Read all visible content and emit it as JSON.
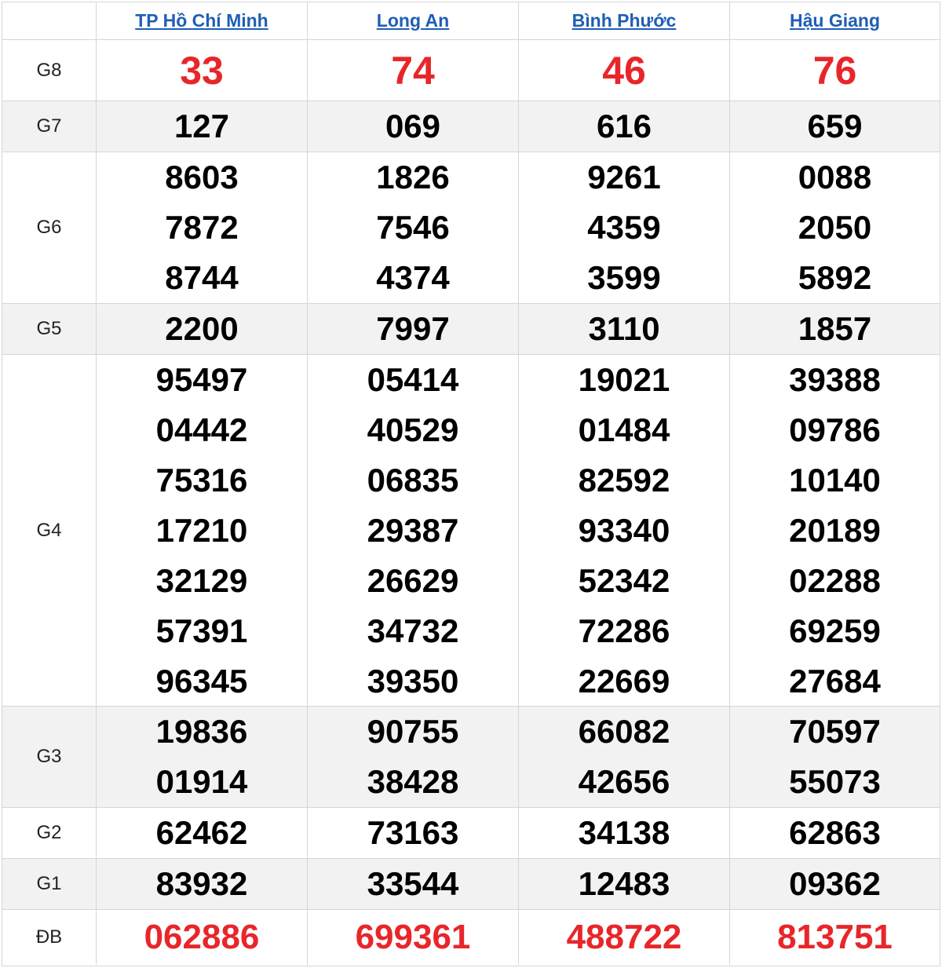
{
  "header": {
    "provinces": [
      "TP Hồ Chí Minh",
      "Long An",
      "Bình Phước",
      "Hậu Giang"
    ]
  },
  "colors": {
    "red": "#e8262a",
    "link": "#1f5eb5",
    "alt_row": "#f2f2f2"
  },
  "rows": [
    {
      "label": "G8",
      "style": "red-big",
      "cols": [
        [
          "33"
        ],
        [
          "74"
        ],
        [
          "46"
        ],
        [
          "76"
        ]
      ]
    },
    {
      "label": "G7",
      "style": "normal",
      "cols": [
        [
          "127"
        ],
        [
          "069"
        ],
        [
          "616"
        ],
        [
          "659"
        ]
      ]
    },
    {
      "label": "G6",
      "style": "normal",
      "cols": [
        [
          "8603",
          "7872",
          "8744"
        ],
        [
          "1826",
          "7546",
          "4374"
        ],
        [
          "9261",
          "4359",
          "3599"
        ],
        [
          "0088",
          "2050",
          "5892"
        ]
      ]
    },
    {
      "label": "G5",
      "style": "normal",
      "cols": [
        [
          "2200"
        ],
        [
          "7997"
        ],
        [
          "3110"
        ],
        [
          "1857"
        ]
      ]
    },
    {
      "label": "G4",
      "style": "normal",
      "cols": [
        [
          "95497",
          "04442",
          "75316",
          "17210",
          "32129",
          "57391",
          "96345"
        ],
        [
          "05414",
          "40529",
          "06835",
          "29387",
          "26629",
          "34732",
          "39350"
        ],
        [
          "19021",
          "01484",
          "82592",
          "93340",
          "52342",
          "72286",
          "22669"
        ],
        [
          "39388",
          "09786",
          "10140",
          "20189",
          "02288",
          "69259",
          "27684"
        ]
      ]
    },
    {
      "label": "G3",
      "style": "normal",
      "cols": [
        [
          "19836",
          "01914"
        ],
        [
          "90755",
          "38428"
        ],
        [
          "66082",
          "42656"
        ],
        [
          "70597",
          "55073"
        ]
      ]
    },
    {
      "label": "G2",
      "style": "normal",
      "cols": [
        [
          "62462"
        ],
        [
          "73163"
        ],
        [
          "34138"
        ],
        [
          "62863"
        ]
      ]
    },
    {
      "label": "G1",
      "style": "normal",
      "cols": [
        [
          "83932"
        ],
        [
          "33544"
        ],
        [
          "12483"
        ],
        [
          "09362"
        ]
      ]
    },
    {
      "label": "ĐB",
      "style": "red-db",
      "cols": [
        [
          "062886"
        ],
        [
          "699361"
        ],
        [
          "488722"
        ],
        [
          "813751"
        ]
      ]
    }
  ]
}
